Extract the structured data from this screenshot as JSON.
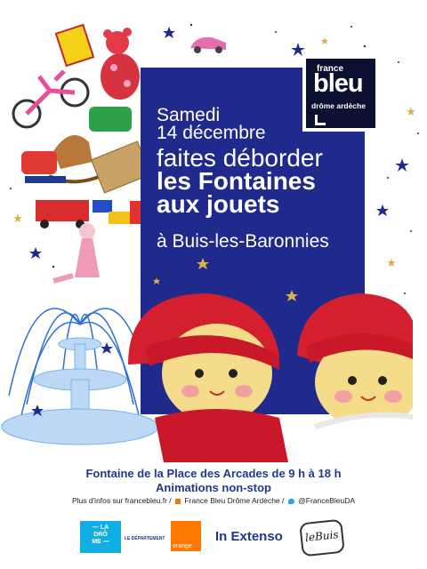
{
  "event": {
    "date_line1": "Samedi",
    "date_line2": "14 décembre",
    "headline_line1": "faites déborder",
    "headline_line2": "les Fontaines",
    "headline_line3": "aux jouets",
    "location": "à Buis-les-Baronnies"
  },
  "brand": {
    "france": "france",
    "bleu": "bleu",
    "region": "drôme ardèche"
  },
  "footer": {
    "place_time": "Fontaine de la Place des Arcades de 9 h à 18 h",
    "animations": "Animations non-stop",
    "info_prefix": "Plus d'infos sur francebleu.fr /",
    "facebook_page": "France Bleu Drôme Ardèche /",
    "twitter_handle": "@FranceBleuDA"
  },
  "sponsors": {
    "drome_l1": "— LA",
    "drome_l2": "DRÔ",
    "drome_l3": "ME —",
    "drome_dept": "LE DÉPARTEMENT",
    "orange": "orange",
    "inextenso": "In Extenso",
    "lebuis": "leBuis"
  },
  "colors": {
    "panel_blue": "#1f2a8c",
    "hat_red": "#d41f2e",
    "footer_blue": "#1f3a8a",
    "fountain_blue": "#2d6fd6"
  }
}
